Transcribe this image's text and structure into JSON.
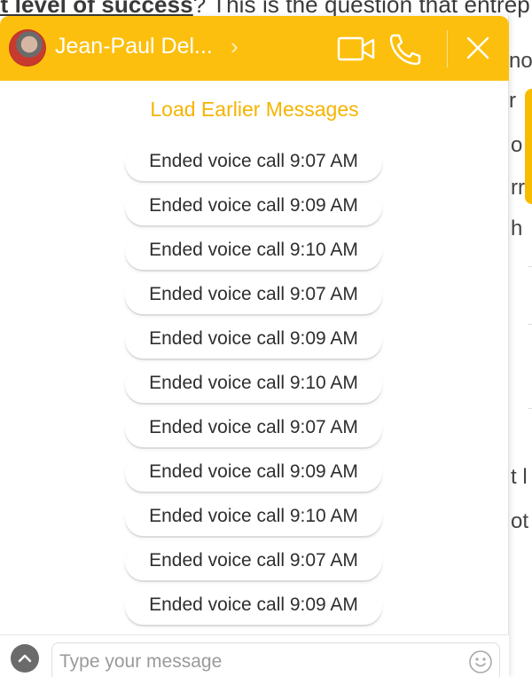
{
  "background": {
    "headline_bold": "xt level of success",
    "headline_rest": "? This is the question that entrep",
    "fragments": [
      "no",
      "r",
      "o",
      "rr",
      "h",
      "t l",
      "ot"
    ]
  },
  "chat": {
    "contact_name": "Jean-Paul Del...",
    "header_chevron": "›",
    "load_earlier_label": "Load Earlier Messages",
    "messages": [
      "Ended voice call 9:07 AM",
      "Ended voice call 9:09 AM",
      "Ended voice call 9:10 AM",
      "Ended voice call 9:07 AM",
      "Ended voice call 9:09 AM",
      "Ended voice call 9:10 AM",
      "Ended voice call 9:07 AM",
      "Ended voice call 9:09 AM",
      "Ended voice call 9:10 AM",
      "Ended voice call 9:07 AM",
      "Ended voice call 9:09 AM"
    ],
    "input_placeholder": "Type your message",
    "icons": {
      "video": "video-camera-icon",
      "phone": "phone-icon",
      "close": "close-icon",
      "expand": "chevron-up-icon",
      "emoji": "smiley-icon"
    },
    "colors": {
      "header": "#fcbf0d",
      "accent_text": "#f5b400"
    }
  }
}
